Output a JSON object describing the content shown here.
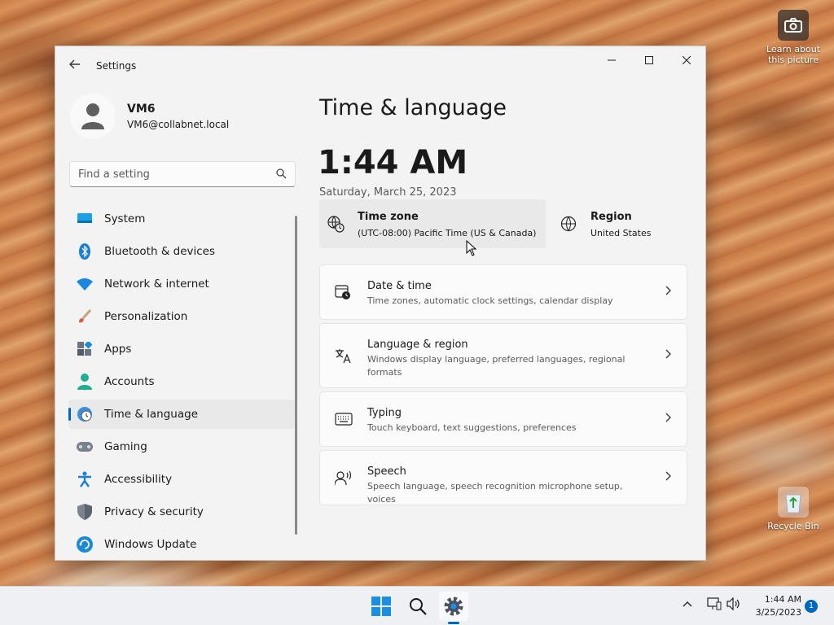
{
  "desktop": {
    "learn_label": "Learn about this picture",
    "recycle_label": "Recycle Bin"
  },
  "window": {
    "title": "Settings",
    "controls": {
      "minimize": "—",
      "maximize": "☐",
      "close": "✕"
    }
  },
  "profile": {
    "name": "VM6",
    "email": "VM6@collabnet.local"
  },
  "search": {
    "placeholder": "Find a setting"
  },
  "nav": {
    "items": [
      {
        "label": "System",
        "icon": "system-icon"
      },
      {
        "label": "Bluetooth & devices",
        "icon": "bluetooth-icon"
      },
      {
        "label": "Network & internet",
        "icon": "wifi-icon"
      },
      {
        "label": "Personalization",
        "icon": "brush-icon"
      },
      {
        "label": "Apps",
        "icon": "apps-icon"
      },
      {
        "label": "Accounts",
        "icon": "accounts-icon"
      },
      {
        "label": "Time & language",
        "icon": "time-language-icon",
        "active": true
      },
      {
        "label": "Gaming",
        "icon": "gamepad-icon"
      },
      {
        "label": "Accessibility",
        "icon": "accessibility-icon"
      },
      {
        "label": "Privacy & security",
        "icon": "shield-icon"
      },
      {
        "label": "Windows Update",
        "icon": "update-icon"
      }
    ]
  },
  "main": {
    "title": "Time & language",
    "clock": "1:44 AM",
    "date": "Saturday, March 25, 2023",
    "timezone": {
      "title": "Time zone",
      "value": "(UTC-08:00) Pacific Time (US & Canada)"
    },
    "region": {
      "title": "Region",
      "value": "United States"
    },
    "cards": [
      {
        "title": "Date & time",
        "subtitle": "Time zones, automatic clock settings, calendar display",
        "icon": "calendar-clock-icon"
      },
      {
        "title": "Language & region",
        "subtitle": "Windows display language, preferred languages, regional formats",
        "icon": "language-icon"
      },
      {
        "title": "Typing",
        "subtitle": "Touch keyboard, text suggestions, preferences",
        "icon": "keyboard-icon"
      },
      {
        "title": "Speech",
        "subtitle": "Speech language, speech recognition microphone setup, voices",
        "icon": "speech-icon"
      }
    ]
  },
  "taskbar": {
    "time": "1:44 AM",
    "date": "3/25/2023",
    "notification_count": "1"
  },
  "colors": {
    "accent": "#0067c0"
  }
}
